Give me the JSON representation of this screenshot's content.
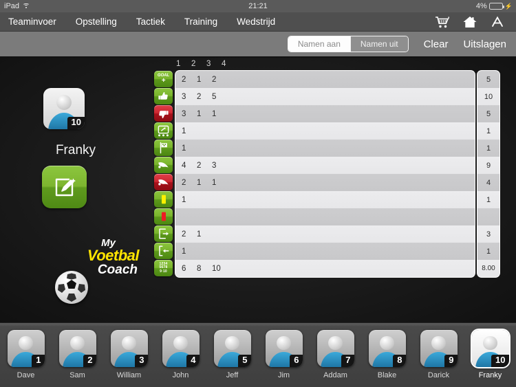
{
  "status_bar": {
    "device": "iPad",
    "wifi_icon": "wifi-icon",
    "time": "21:21",
    "battery_percent": "4%",
    "battery_level": 4,
    "charging_icon": "lightning-bolt-icon"
  },
  "nav_bar": {
    "items": [
      {
        "label": "Teaminvoer"
      },
      {
        "label": "Opstelling"
      },
      {
        "label": "Tactiek"
      },
      {
        "label": "Training"
      },
      {
        "label": "Wedstrijd"
      }
    ],
    "icons": [
      {
        "name": "shopping-cart-icon"
      },
      {
        "name": "home-icon"
      },
      {
        "name": "app-store-icon"
      }
    ]
  },
  "toolbar": {
    "segmented": {
      "options": [
        {
          "label": "Namen aan",
          "selected": true
        },
        {
          "label": "Namen uit",
          "selected": false
        }
      ]
    },
    "clear_label": "Clear",
    "results_label": "Uitslagen"
  },
  "player_panel": {
    "avatar_number": "10",
    "player_name": "Franky",
    "edit_icon": "edit-pencil-square-icon"
  },
  "logo": {
    "line1": "My",
    "line2": "Voetbal",
    "line3": "Coach",
    "accent_color": "#ffe400",
    "ball_icon": "soccer-ball-icon"
  },
  "stat_table": {
    "column_headers": [
      "1",
      "2",
      "3",
      "4"
    ],
    "rows": [
      {
        "icon": "goal-plus-icon",
        "icon_color": "green",
        "values": [
          "2",
          "1",
          "2",
          ""
        ],
        "total": "5"
      },
      {
        "icon": "thumbs-up-icon",
        "icon_color": "green",
        "values": [
          "3",
          "2",
          "5",
          ""
        ],
        "total": "10"
      },
      {
        "icon": "thumbs-down-icon",
        "icon_color": "red",
        "values": [
          "3",
          "1",
          "1",
          ""
        ],
        "total": "5"
      },
      {
        "icon": "assist-pass-icon",
        "icon_color": "green",
        "values": [
          "1",
          "",
          "",
          ""
        ],
        "total": "1"
      },
      {
        "icon": "corner-flag-icon",
        "icon_color": "green",
        "values": [
          "1",
          "",
          "",
          ""
        ],
        "total": "1"
      },
      {
        "icon": "kick-shot-green-icon",
        "icon_color": "green",
        "values": [
          "4",
          "2",
          "3",
          ""
        ],
        "total": "9"
      },
      {
        "icon": "kick-shot-red-icon",
        "icon_color": "red",
        "values": [
          "2",
          "1",
          "1",
          ""
        ],
        "total": "4"
      },
      {
        "icon": "yellow-card-icon",
        "icon_color": "green",
        "values": [
          "1",
          "",
          "",
          ""
        ],
        "total": "1"
      },
      {
        "icon": "red-card-icon",
        "icon_color": "green",
        "values": [
          "",
          "",
          "",
          ""
        ],
        "total": ""
      },
      {
        "icon": "substitute-out-icon",
        "icon_color": "green",
        "values": [
          "2",
          "1",
          "",
          ""
        ],
        "total": "3"
      },
      {
        "icon": "substitute-in-icon",
        "icon_color": "green",
        "values": [
          "1",
          "",
          "",
          ""
        ],
        "total": "1"
      },
      {
        "icon": "rating-numbers-icon",
        "icon_color": "green",
        "values": [
          "6",
          "8",
          "10",
          ""
        ],
        "total": "8.00"
      }
    ]
  },
  "player_bar": {
    "players": [
      {
        "number": "1",
        "name": "Dave",
        "selected": false
      },
      {
        "number": "2",
        "name": "Sam",
        "selected": false
      },
      {
        "number": "3",
        "name": "William",
        "selected": false
      },
      {
        "number": "4",
        "name": "John",
        "selected": false
      },
      {
        "number": "5",
        "name": "Jeff",
        "selected": false
      },
      {
        "number": "6",
        "name": "Jim",
        "selected": false
      },
      {
        "number": "7",
        "name": "Addam",
        "selected": false
      },
      {
        "number": "8",
        "name": "Blake",
        "selected": false
      },
      {
        "number": "9",
        "name": "Darick",
        "selected": false
      },
      {
        "number": "10",
        "name": "Franky",
        "selected": true
      }
    ]
  }
}
